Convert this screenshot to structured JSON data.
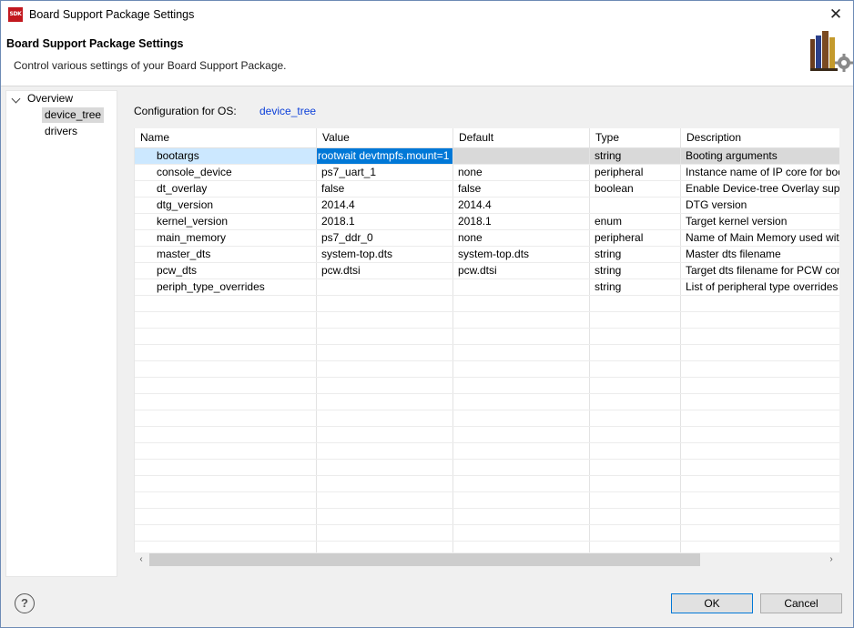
{
  "window": {
    "title": "Board Support Package Settings",
    "app_icon": "SDK",
    "close_glyph": "✕"
  },
  "header": {
    "title": "Board Support Package Settings",
    "subtitle": "Control various settings of your Board Support Package.",
    "icon": "books-gear-icon"
  },
  "tree": {
    "root": "Overview",
    "children": [
      "device_tree",
      "drivers"
    ],
    "selected": "device_tree"
  },
  "config": {
    "label": "Configuration for OS:",
    "os": "device_tree"
  },
  "table": {
    "columns": [
      "Name",
      "Value",
      "Default",
      "Type",
      "Description"
    ],
    "rows": [
      {
        "name": "bootargs",
        "value": "rootwait devtmpfs.mount=1",
        "default": "",
        "type": "string",
        "description": "Booting arguments"
      },
      {
        "name": "console_device",
        "value": "ps7_uart_1",
        "default": "none",
        "type": "peripheral",
        "description": "Instance name of IP core for boo"
      },
      {
        "name": "dt_overlay",
        "value": "false",
        "default": "false",
        "type": "boolean",
        "description": "Enable Device-tree Overlay supp"
      },
      {
        "name": "dtg_version",
        "value": "2014.4",
        "default": "2014.4",
        "type": "",
        "description": "DTG version"
      },
      {
        "name": "kernel_version",
        "value": "2018.1",
        "default": "2018.1",
        "type": "enum",
        "description": "Target kernel version"
      },
      {
        "name": "main_memory",
        "value": "ps7_ddr_0",
        "default": "none",
        "type": "peripheral",
        "description": "Name of Main Memory used wit"
      },
      {
        "name": "master_dts",
        "value": "system-top.dts",
        "default": "system-top.dts",
        "type": "string",
        "description": "Master dts filename"
      },
      {
        "name": "pcw_dts",
        "value": "pcw.dtsi",
        "default": "pcw.dtsi",
        "type": "string",
        "description": "Target dts filename for PCW cont"
      },
      {
        "name": "periph_type_overrides",
        "value": "",
        "default": "",
        "type": "string",
        "description": "List of peripheral type overrides"
      }
    ],
    "selected_row": 0
  },
  "scrollbar": {
    "left_arrow": "‹",
    "right_arrow": "›"
  },
  "footer": {
    "help_glyph": "?",
    "ok_label": "OK",
    "cancel_label": "Cancel"
  }
}
